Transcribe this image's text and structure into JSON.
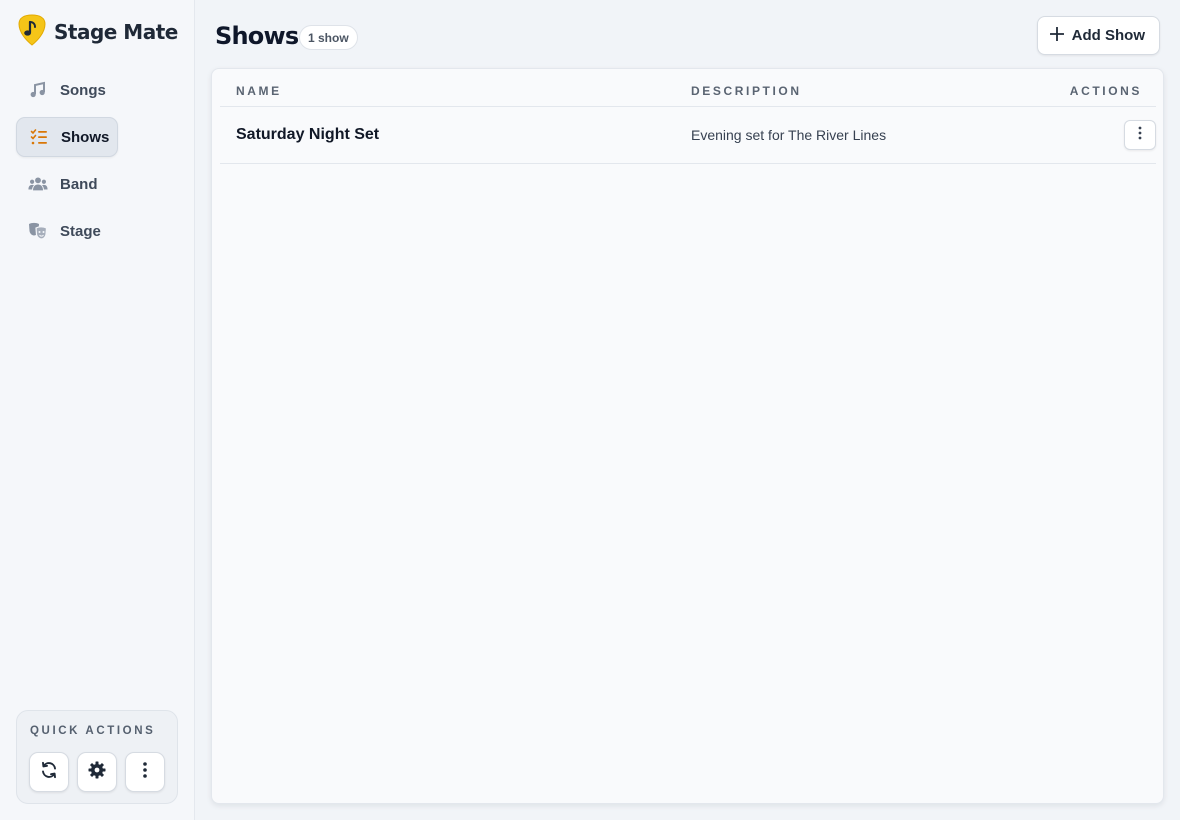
{
  "app": {
    "name": "Stage Mate",
    "logo_icon": "music-note-pick-icon",
    "accent": "#f5c518"
  },
  "sidebar": {
    "items": [
      {
        "label": "Songs",
        "icon": "music-note-icon",
        "active": false
      },
      {
        "label": "Shows",
        "icon": "checklist-icon",
        "active": true
      },
      {
        "label": "Band",
        "icon": "users-icon",
        "active": false
      },
      {
        "label": "Stage",
        "icon": "theater-masks-icon",
        "active": false
      }
    ],
    "quick_actions": {
      "title": "QUICK ACTIONS",
      "buttons": [
        {
          "icon": "refresh-icon"
        },
        {
          "icon": "gear-icon"
        },
        {
          "icon": "more-vertical-icon"
        }
      ]
    }
  },
  "page": {
    "title": "Shows",
    "count_badge": "1 show",
    "add_button": "Add Show"
  },
  "table": {
    "columns": [
      "NAME",
      "DESCRIPTION",
      "ACTIONS"
    ],
    "rows": [
      {
        "name": "Saturday Night Set",
        "description": "Evening set for The River Lines"
      }
    ]
  },
  "colors": {
    "active_icon": "#d97706",
    "muted_icon": "#8a94a3"
  }
}
